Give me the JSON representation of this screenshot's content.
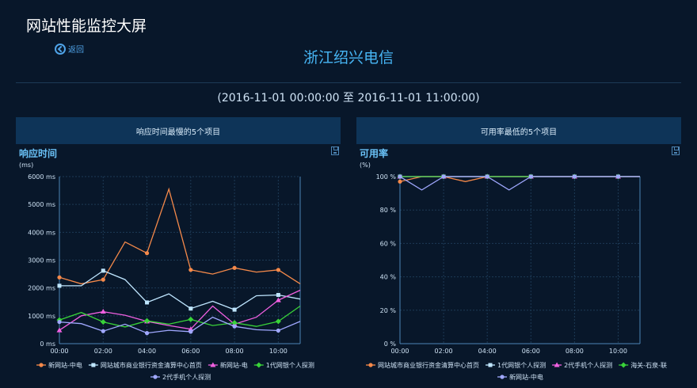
{
  "header": {
    "app_title": "网站性能监控大屏",
    "back_label": "返回",
    "region": "浙江绍兴电信",
    "time_range": "(2016-11-01 00:00:00 至 2016-11-01 11:00:00)"
  },
  "panels": {
    "left_header": "响应时间最慢的5个项目",
    "right_header": "可用率最低的5个项目"
  },
  "colors": {
    "orange": "#f5894a",
    "lightblue": "#bfe6ff",
    "pink": "#f060e0",
    "green": "#39d339",
    "periwinkle": "#a0a8ff"
  },
  "chart_data": [
    {
      "type": "line",
      "title": "响应时间",
      "ylabel": "(ms)",
      "x": [
        "00:00",
        "01:00",
        "02:00",
        "03:00",
        "04:00",
        "05:00",
        "06:00",
        "07:00",
        "08:00",
        "09:00",
        "10:00",
        "11:00"
      ],
      "xticks": [
        "00:00",
        "02:00",
        "04:00",
        "06:00",
        "08:00",
        "10:00"
      ],
      "yticks": [
        "0 ms",
        "1000 ms",
        "2000 ms",
        "3000 ms",
        "4000 ms",
        "5000 ms",
        "6000 ms"
      ],
      "ylim": [
        0,
        6000
      ],
      "grid": true,
      "legend_position": "bottom",
      "series": [
        {
          "name": "新网站-中电",
          "color": "#f5894a",
          "marker": "circle",
          "values": [
            2380,
            2150,
            2300,
            3650,
            3250,
            5550,
            2650,
            2500,
            2720,
            2570,
            2650,
            2150
          ]
        },
        {
          "name": "网站城市商业银行资金清算中心首页",
          "color": "#bfe6ff",
          "marker": "square",
          "values": [
            2080,
            2080,
            2620,
            2300,
            1480,
            1790,
            1260,
            1520,
            1220,
            1720,
            1750,
            1600
          ]
        },
        {
          "name": "新网站-电",
          "color": "#f060e0",
          "marker": "triangle",
          "values": [
            480,
            1000,
            1150,
            1020,
            800,
            650,
            520,
            1350,
            700,
            950,
            1560,
            1920
          ]
        },
        {
          "name": "1代网银个人探测",
          "color": "#39d339",
          "marker": "diamond",
          "values": [
            850,
            1120,
            780,
            600,
            820,
            700,
            870,
            650,
            750,
            620,
            800,
            1350
          ]
        },
        {
          "name": "2代手机个人探测",
          "color": "#a0a8ff",
          "marker": "circle",
          "values": [
            780,
            720,
            450,
            700,
            380,
            480,
            430,
            950,
            620,
            500,
            470,
            800
          ]
        }
      ]
    },
    {
      "type": "line",
      "title": "可用率",
      "ylabel": "(%)",
      "x": [
        "00:00",
        "01:00",
        "02:00",
        "03:00",
        "04:00",
        "05:00",
        "06:00",
        "07:00",
        "08:00",
        "09:00",
        "10:00",
        "11:00"
      ],
      "xticks": [
        "00:00",
        "02:00",
        "04:00",
        "06:00",
        "08:00",
        "10:00"
      ],
      "yticks": [
        "0 %",
        "20 %",
        "40 %",
        "60 %",
        "80 %",
        "100 %"
      ],
      "ylim": [
        0,
        100
      ],
      "grid": true,
      "legend_position": "bottom",
      "series": [
        {
          "name": "网站城市商业银行资金清算中心首页",
          "color": "#f5894a",
          "marker": "circle",
          "values": [
            97,
            100,
            100,
            97,
            100,
            100,
            100,
            100,
            100,
            100,
            100,
            100
          ]
        },
        {
          "name": "1代网银个人探测",
          "color": "#bfe6ff",
          "marker": "square",
          "values": [
            100,
            100,
            100,
            100,
            100,
            100,
            100,
            100,
            100,
            100,
            100,
            100
          ]
        },
        {
          "name": "2代手机个人探测",
          "color": "#f060e0",
          "marker": "triangle",
          "values": [
            100,
            100,
            100,
            100,
            100,
            100,
            100,
            100,
            100,
            100,
            100,
            100
          ]
        },
        {
          "name": "海关-石泉-联",
          "color": "#39d339",
          "marker": "diamond",
          "values": [
            100,
            100,
            100,
            100,
            100,
            100,
            100,
            100,
            100,
            100,
            100,
            100
          ]
        },
        {
          "name": "新网站-中电",
          "color": "#a0a8ff",
          "marker": "circle",
          "values": [
            100,
            92,
            100,
            100,
            100,
            92,
            100,
            100,
            100,
            100,
            100,
            100
          ]
        }
      ]
    }
  ]
}
